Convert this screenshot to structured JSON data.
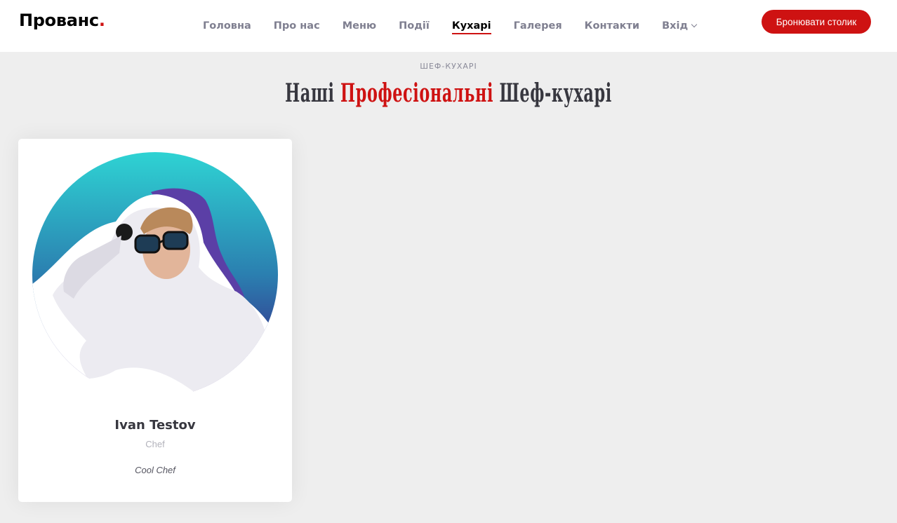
{
  "header": {
    "logo_text": "Прованс",
    "logo_dot": ".",
    "nav": [
      {
        "label": "Головна"
      },
      {
        "label": "Про нас"
      },
      {
        "label": "Меню"
      },
      {
        "label": "Події"
      },
      {
        "label": "Кухарі",
        "active": true
      },
      {
        "label": "Галерея"
      },
      {
        "label": "Контакти"
      },
      {
        "label": "Вхід",
        "has_dropdown": true
      }
    ],
    "cta_label": "Бронювати столик"
  },
  "section": {
    "subtitle": "ШЕФ-КУХАРІ",
    "title_part1": "Наші ",
    "title_accent": "Професіональні",
    "title_part2": " Шеф-кухарі"
  },
  "chefs": [
    {
      "name": "Ivan Testov",
      "role": "Chef",
      "description": "Cool Chef"
    }
  ],
  "colors": {
    "accent": "#ce1212",
    "page_bg": "#eeeeee",
    "photo_gradient_top": "#2ed3d3",
    "photo_gradient_bottom": "#3a0a78",
    "photo_back_shape": "#5b3fa6"
  }
}
